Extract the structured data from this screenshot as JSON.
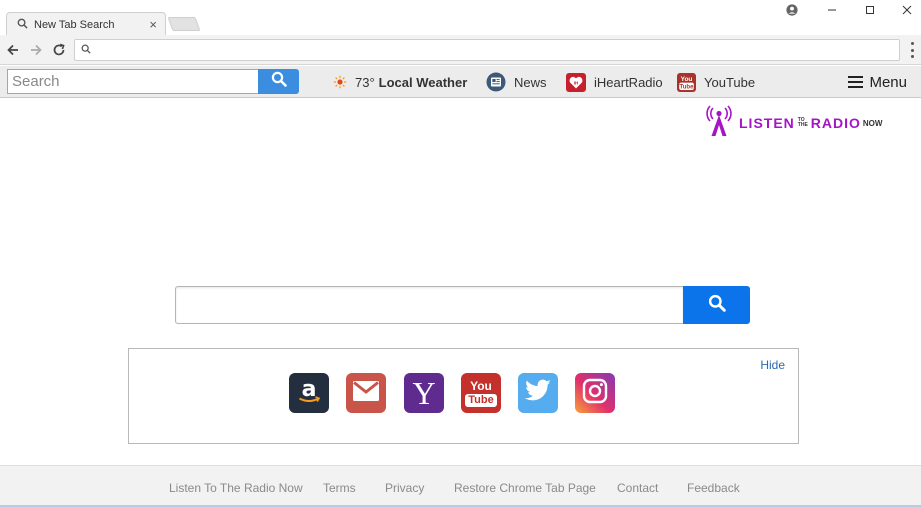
{
  "browser": {
    "tab_title": "New Tab Search",
    "tab_close": "×",
    "omnibox_value": ""
  },
  "extension_bar": {
    "search_placeholder": "Search",
    "weather_temp": "73°",
    "weather_label": "Local Weather",
    "news_label": "News",
    "iheart_label": "iHeartRadio",
    "youtube_label": "YouTube",
    "menu_label": "Menu"
  },
  "logo": {
    "part1": "LISTEN",
    "part2a": "TO",
    "part2b": "THE",
    "part3": "RADIO",
    "part4": "NOW"
  },
  "main_search": {
    "value": ""
  },
  "quick_links": {
    "hide_label": "Hide",
    "youtube_tile_top": "You",
    "youtube_tile_bottom": "Tube",
    "yahoo_letter": "Y"
  },
  "footer": {
    "links": [
      "Listen To The Radio Now",
      "Terms",
      "Privacy",
      "Restore Chrome Tab Page",
      "Contact",
      "Feedback"
    ]
  },
  "colors": {
    "accent_blue": "#0b74ea",
    "ext_search_blue": "#3b8de0",
    "logo_purple": "#a514c6",
    "amazon": "#232f3e",
    "gmail": "#c9554a",
    "yahoo": "#5f2b8f",
    "youtube": "#c4302b",
    "twitter": "#55acee"
  }
}
